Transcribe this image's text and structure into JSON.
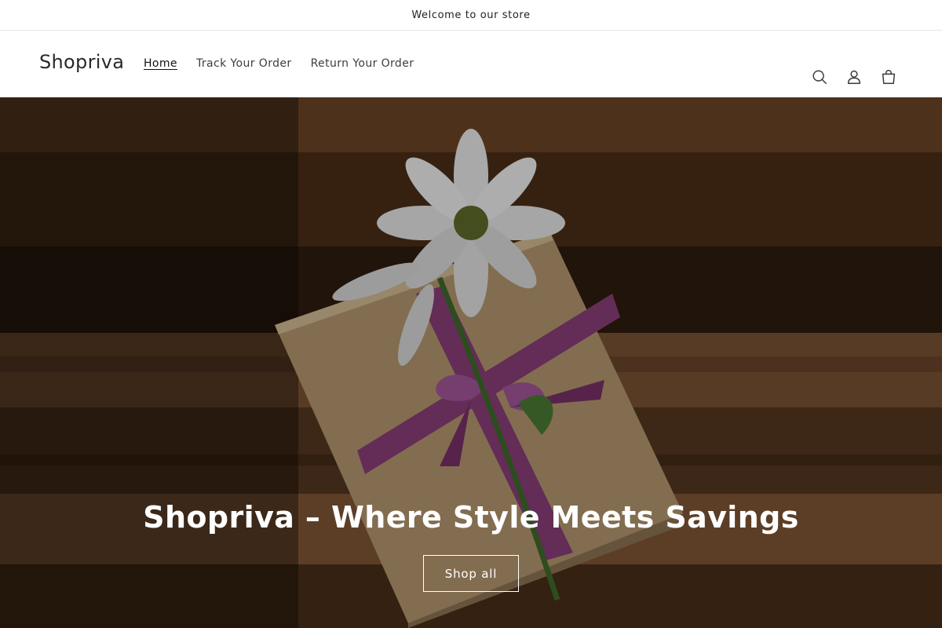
{
  "announcement": {
    "text": "Welcome to our store"
  },
  "header": {
    "logo": "Shopriva",
    "nav": [
      {
        "label": "Home",
        "active": true
      },
      {
        "label": "Track Your Order",
        "active": false
      },
      {
        "label": "Return Your Order",
        "active": false
      }
    ],
    "icons": [
      "search-icon",
      "account-icon",
      "cart-icon"
    ]
  },
  "hero": {
    "title": "Shopriva – Where Style Meets Savings",
    "button_label": "Shop all",
    "image_subject": "gift box with white flower and purple ribbon on wooden table"
  },
  "colors": {
    "text": "#121212",
    "hero_overlay": "#000000",
    "ribbon": "#8c4a7e",
    "box": "#b99b74"
  }
}
